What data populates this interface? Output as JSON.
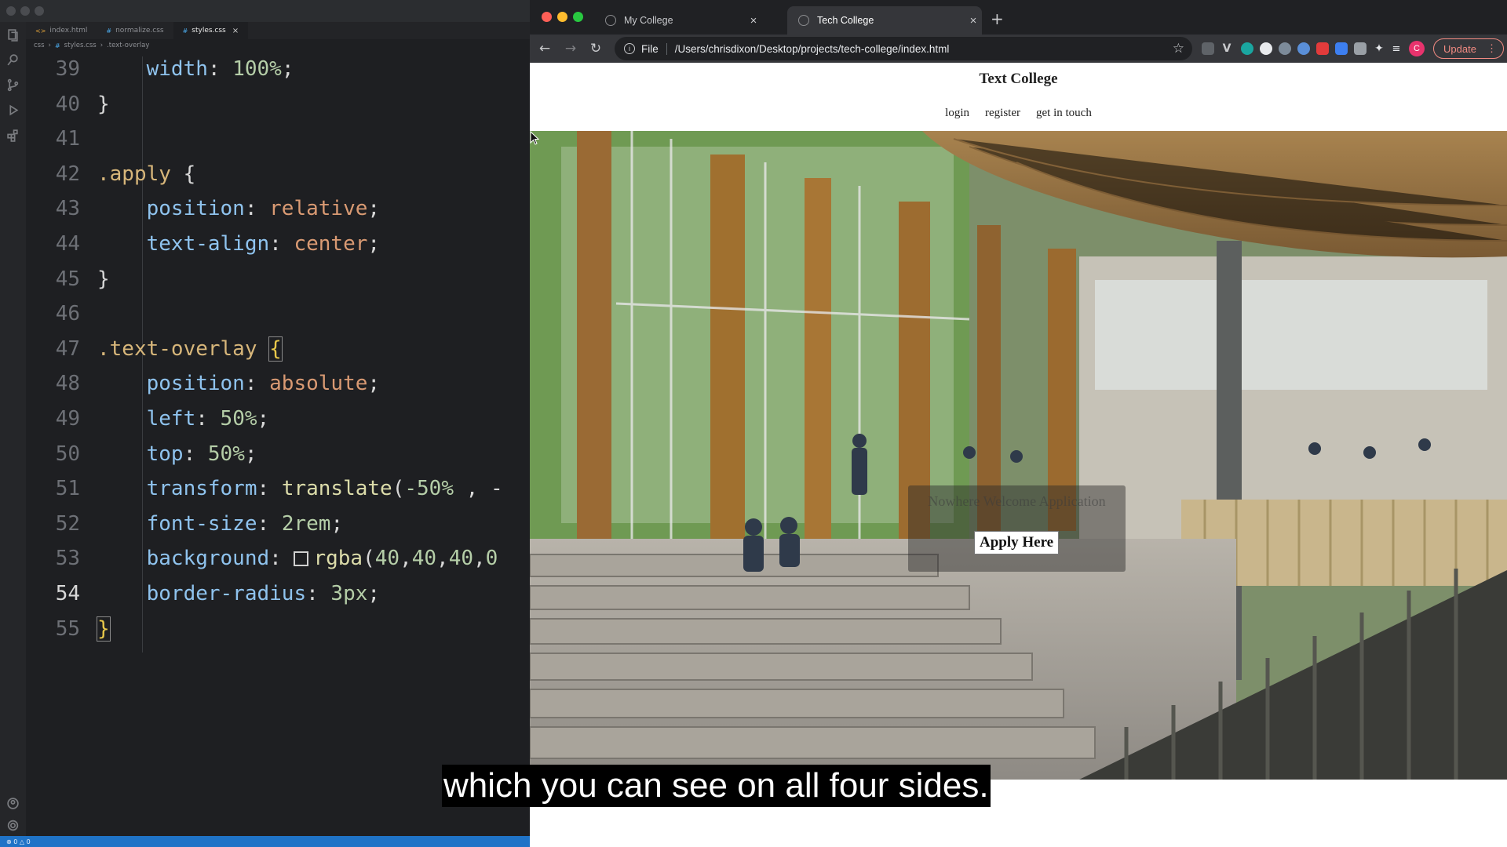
{
  "editor": {
    "tabs": [
      {
        "label": "index.html",
        "icon": "html-file-icon",
        "active": false
      },
      {
        "label": "normalize.css",
        "icon": "css-file-icon",
        "active": false
      },
      {
        "label": "styles.css",
        "icon": "css-file-icon",
        "active": true
      }
    ],
    "breadcrumb": [
      "css",
      "styles.css",
      ".text-overlay"
    ],
    "current_line": 54,
    "lines": [
      {
        "n": "39",
        "tokens": [
          {
            "t": "    width",
            "c": "prop"
          },
          {
            "t": ": ",
            "c": "punc"
          },
          {
            "t": "100%",
            "c": "num"
          },
          {
            "t": ";",
            "c": "punc"
          }
        ]
      },
      {
        "n": "40",
        "tokens": [
          {
            "t": "}",
            "c": "punc"
          }
        ]
      },
      {
        "n": "41",
        "tokens": []
      },
      {
        "n": "42",
        "tokens": [
          {
            "t": ".apply",
            "c": "sel"
          },
          {
            "t": " {",
            "c": "punc"
          }
        ]
      },
      {
        "n": "43",
        "tokens": [
          {
            "t": "    position",
            "c": "prop"
          },
          {
            "t": ": ",
            "c": "punc"
          },
          {
            "t": "relative",
            "c": "val"
          },
          {
            "t": ";",
            "c": "punc"
          }
        ]
      },
      {
        "n": "44",
        "tokens": [
          {
            "t": "    text-align",
            "c": "prop"
          },
          {
            "t": ": ",
            "c": "punc"
          },
          {
            "t": "center",
            "c": "val"
          },
          {
            "t": ";",
            "c": "punc"
          }
        ]
      },
      {
        "n": "45",
        "tokens": [
          {
            "t": "}",
            "c": "punc"
          }
        ]
      },
      {
        "n": "46",
        "tokens": []
      },
      {
        "n": "47",
        "tokens": [
          {
            "t": ".text-overlay",
            "c": "sel"
          },
          {
            "t": " ",
            "c": "punc"
          },
          {
            "t": "{",
            "c": "brace"
          }
        ]
      },
      {
        "n": "48",
        "tokens": [
          {
            "t": "    position",
            "c": "prop"
          },
          {
            "t": ": ",
            "c": "punc"
          },
          {
            "t": "absolute",
            "c": "val"
          },
          {
            "t": ";",
            "c": "punc"
          }
        ]
      },
      {
        "n": "49",
        "tokens": [
          {
            "t": "    left",
            "c": "prop"
          },
          {
            "t": ": ",
            "c": "punc"
          },
          {
            "t": "50%",
            "c": "num"
          },
          {
            "t": ";",
            "c": "punc"
          }
        ]
      },
      {
        "n": "50",
        "tokens": [
          {
            "t": "    top",
            "c": "prop"
          },
          {
            "t": ": ",
            "c": "punc"
          },
          {
            "t": "50%",
            "c": "num"
          },
          {
            "t": ";",
            "c": "punc"
          }
        ]
      },
      {
        "n": "51",
        "tokens": [
          {
            "t": "    transform",
            "c": "prop"
          },
          {
            "t": ": ",
            "c": "punc"
          },
          {
            "t": "translate",
            "c": "fn"
          },
          {
            "t": "(",
            "c": "punc"
          },
          {
            "t": "-50%",
            "c": "num"
          },
          {
            "t": " , -",
            "c": "punc"
          }
        ]
      },
      {
        "n": "52",
        "tokens": [
          {
            "t": "    font-size",
            "c": "prop"
          },
          {
            "t": ": ",
            "c": "punc"
          },
          {
            "t": "2rem",
            "c": "num"
          },
          {
            "t": ";",
            "c": "punc"
          }
        ]
      },
      {
        "n": "53",
        "tokens": [
          {
            "t": "    background",
            "c": "prop"
          },
          {
            "t": ": ",
            "c": "punc"
          },
          {
            "t": "",
            "c": "swatch"
          },
          {
            "t": "rgba",
            "c": "fn"
          },
          {
            "t": "(",
            "c": "punc"
          },
          {
            "t": "40",
            "c": "num"
          },
          {
            "t": ",",
            "c": "punc"
          },
          {
            "t": "40",
            "c": "num"
          },
          {
            "t": ",",
            "c": "punc"
          },
          {
            "t": "40",
            "c": "num"
          },
          {
            "t": ",",
            "c": "punc"
          },
          {
            "t": "0",
            "c": "num"
          }
        ]
      },
      {
        "n": "54",
        "tokens": [
          {
            "t": "    border-radius",
            "c": "prop"
          },
          {
            "t": ": ",
            "c": "punc"
          },
          {
            "t": "3px",
            "c": "num"
          },
          {
            "t": ";",
            "c": "punc"
          }
        ]
      },
      {
        "n": "55",
        "tokens": [
          {
            "t": "}",
            "c": "brace"
          }
        ]
      }
    ]
  },
  "browser": {
    "tabs": [
      {
        "title": "My College",
        "active": false
      },
      {
        "title": "Tech College",
        "active": true
      }
    ],
    "address_scheme": "File",
    "address": "/Users/chrisdixon/Desktop/projects/tech-college/index.html",
    "profile_initial": "C",
    "update_label": "Update"
  },
  "page": {
    "site_title": "Text College",
    "nav": [
      "login",
      "register",
      "get in touch"
    ],
    "overlay_text": "Nowhere Welcome Application",
    "apply_button": "Apply Here"
  },
  "caption": "which you can see on all four sides.",
  "colors": {
    "editor_bg": "#1e1f22",
    "chrome_dark": "#202124",
    "status_bar": "#1f73c7",
    "update_accent": "#f28b82"
  }
}
